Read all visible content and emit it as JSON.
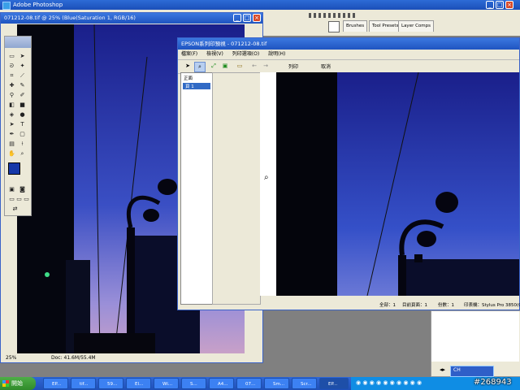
{
  "ps": {
    "title": "Adobe Photoshop"
  },
  "palette_tabs": [
    "Brushes",
    "Tool Presets",
    "Layer Comps"
  ],
  "doc": {
    "title": "071212-08.tif @ 25% (Blue(Saturation 1, RGB/16)",
    "zoom": "25%",
    "docsize": "Doc: 41.6M/55.4M"
  },
  "epson": {
    "title": "EPSON系列印預視 - 071212-08.tif",
    "menu": [
      "檔案(F)",
      "檢視(V)",
      "列印選項(O)",
      "說明(H)"
    ],
    "print": "列印",
    "cancel": "取消",
    "tree_root": "正面",
    "tree_item": "頁 1",
    "status": {
      "total": "全部：1",
      "current": "目前頁面：1",
      "copies": "份數：1",
      "printer": "印表機：Stylus Pro 3850(C"
    }
  },
  "taskbar": {
    "start": "開始",
    "items": [
      "EP...",
      "tif...",
      "59...",
      "El...",
      "Wi...",
      "S...",
      "A4...",
      "07...",
      "Sm...",
      "Scr...",
      "EP..."
    ],
    "lang": "CH"
  },
  "watermark": "#268943"
}
